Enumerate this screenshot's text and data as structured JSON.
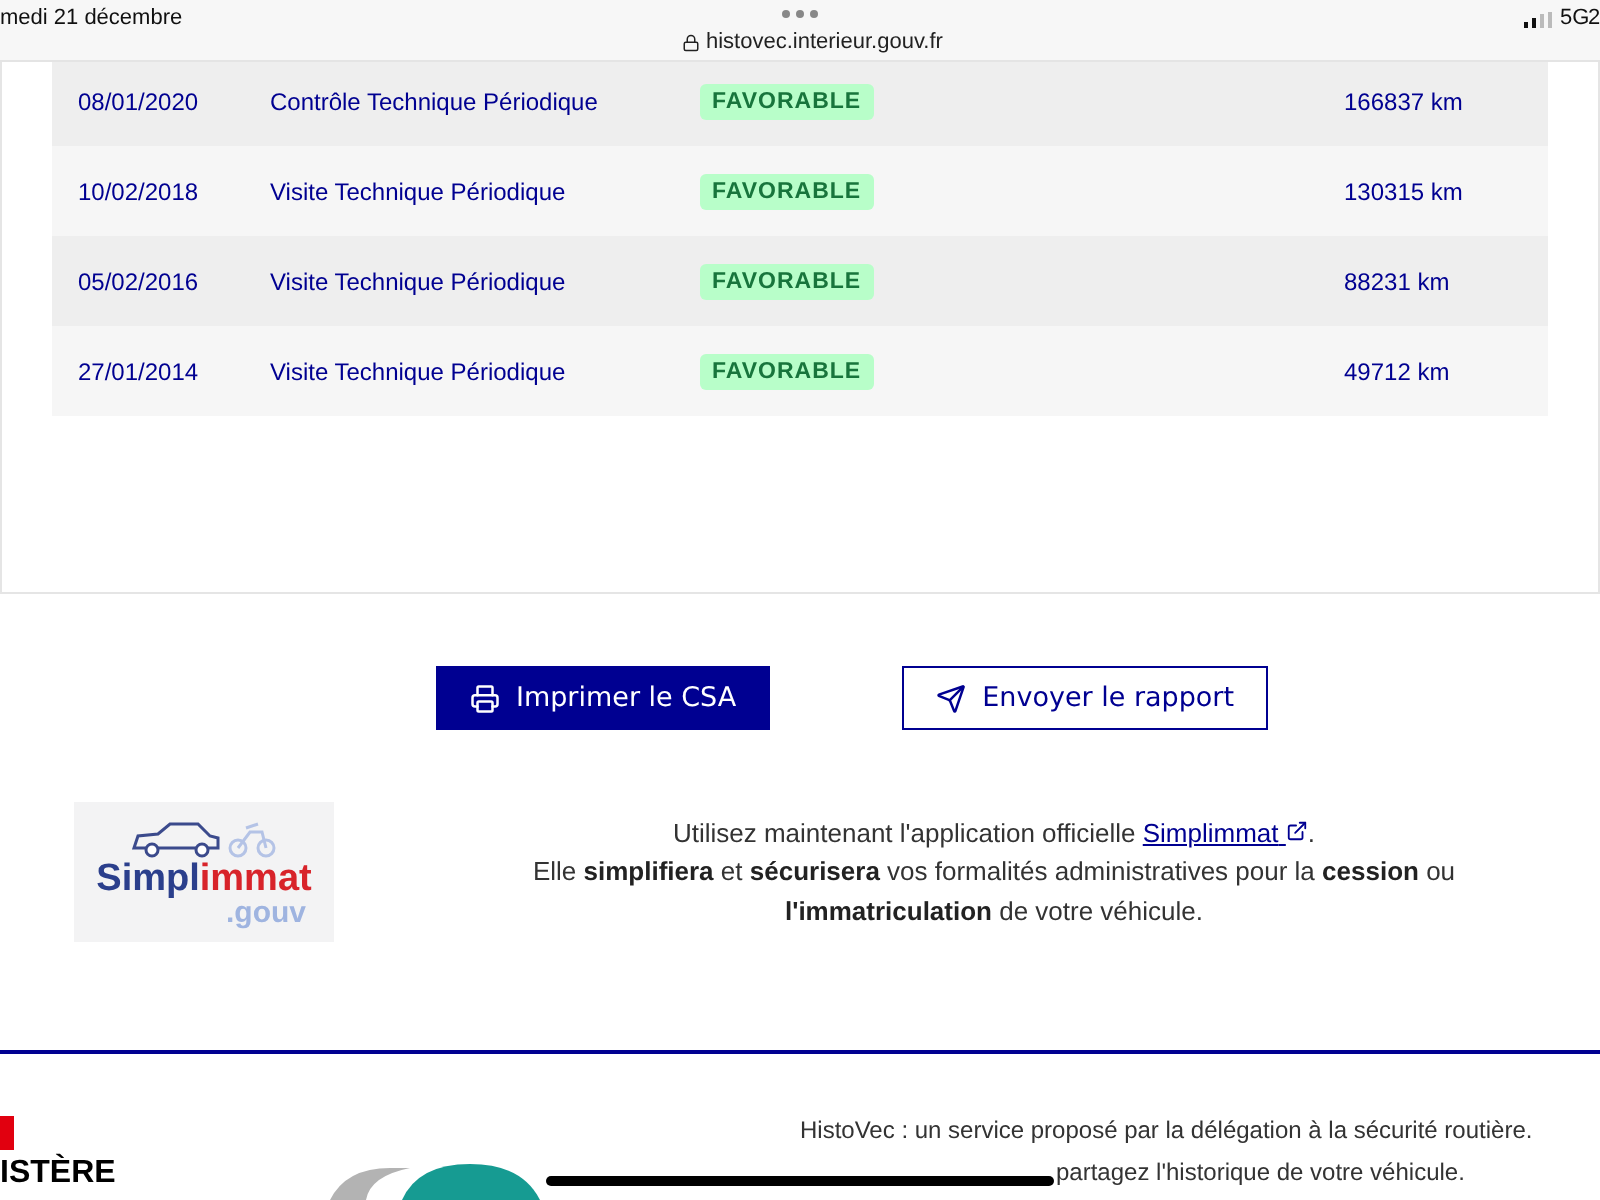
{
  "status_bar": {
    "date": "medi 21 décembre",
    "url": "histovec.interieur.gouv.fr",
    "network": "5G",
    "battery": "2"
  },
  "history": {
    "rows": [
      {
        "date": "08/01/2020",
        "type": "Contrôle Technique Périodique",
        "result": "FAVORABLE",
        "mileage": "166837 km"
      },
      {
        "date": "10/02/2018",
        "type": "Visite Technique Périodique",
        "result": "FAVORABLE",
        "mileage": "130315 km"
      },
      {
        "date": "05/02/2016",
        "type": "Visite Technique Périodique",
        "result": "FAVORABLE",
        "mileage": "88231 km"
      },
      {
        "date": "27/01/2014",
        "type": "Visite Technique Périodique",
        "result": "FAVORABLE",
        "mileage": "49712 km"
      }
    ]
  },
  "actions": [
    {
      "label": "Imprimer le CSA",
      "kind": "primary"
    },
    {
      "label": "Envoyer le rapport",
      "kind": "secondary"
    }
  ],
  "promo": {
    "logo": {
      "parts": [
        {
          "text": "Simpl",
          "color": "#2b3f8c"
        },
        {
          "text": "immat",
          "color": "#d8232a"
        }
      ],
      "suffix": ".gouv"
    },
    "intro": "Utilisez maintenant l'application officielle ",
    "link": "Simplimmat",
    "after": ".",
    "body": "Elle **simplifiera** et **sécurisera** vos formalités administratives pour la **cession** ou **l'immatriculation** de votre véhicule."
  },
  "footer": {
    "ministry": "ISTÈRE",
    "lines": [
      "HistoVec : un service proposé par la délégation à la sécurité routière.",
      "partagez l'historique de votre véhicule."
    ]
  }
}
